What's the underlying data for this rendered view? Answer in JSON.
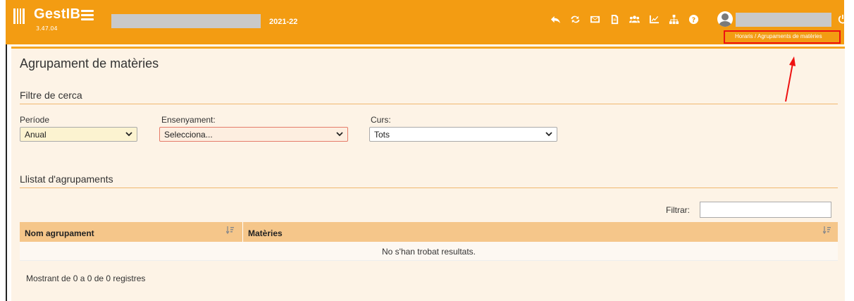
{
  "header": {
    "brand": "GestIB",
    "version": "3.47.04",
    "year": "2021-22",
    "breadcrumb": "Horaris / Agrupaments de matèries",
    "icons": [
      "reply-icon",
      "refresh-icon",
      "mail-icon",
      "document-icon",
      "users-icon",
      "chart-icon",
      "sitemap-icon",
      "help-icon"
    ],
    "accent_color": "#f39c12"
  },
  "page": {
    "title": "Agrupament de matèries",
    "filter_section": "Filtre de cerca",
    "list_section": "Llistat d'agrupaments"
  },
  "filters": {
    "periode_label": "Període",
    "periode_value": "Anual",
    "ensenyament_label": "Ensenyament:",
    "ensenyament_value": "Selecciona...",
    "curs_label": "Curs:",
    "curs_value": "Tots"
  },
  "table": {
    "filter_label": "Filtrar:",
    "columns": [
      "Nom agrupament",
      "Matèries"
    ],
    "empty_message": "No s'han trobat resultats.",
    "info": "Mostrant de 0 a 0 de 0 registres"
  }
}
